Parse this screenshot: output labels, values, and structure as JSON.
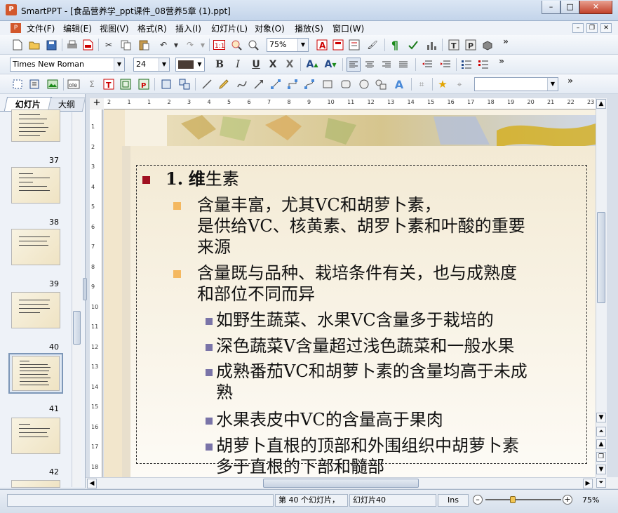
{
  "window": {
    "title": "SmartPPT - [食品营养学_ppt课件_08营养5章 (1).ppt]",
    "app_icon_letter": "P",
    "minimize": "–",
    "maximize": "□",
    "close": "✕"
  },
  "menu": {
    "items": [
      "文件(F)",
      "编辑(E)",
      "视图(V)",
      "格式(R)",
      "插入(I)",
      "幻灯片(L)",
      "对象(O)",
      "播放(S)",
      "窗口(W)"
    ],
    "mdi_min": "–",
    "mdi_restore": "❐",
    "mdi_close": "✕"
  },
  "toolbar1": {
    "zoom": "75%",
    "more": "»"
  },
  "toolbar2": {
    "font": "Times New Roman",
    "size": "24",
    "bold": "B",
    "italic": "I",
    "underline": "U",
    "strike": "X",
    "shadow": "X",
    "grow": "A",
    "shrink": "A",
    "more": "»"
  },
  "toolbar3": {
    "more": "»"
  },
  "panel": {
    "tabs": [
      "幻灯片",
      "大纲"
    ],
    "thumb_numbers": [
      "37",
      "38",
      "39",
      "40",
      "41",
      "42"
    ]
  },
  "ruler": {
    "corner": "+",
    "h_ticks": [
      "2",
      "1",
      "1",
      "2",
      "3",
      "4",
      "5",
      "6",
      "7",
      "8",
      "9",
      "10",
      "11",
      "12",
      "13",
      "14",
      "15",
      "16",
      "17",
      "18",
      "19",
      "20",
      "21",
      "22",
      "23",
      "24",
      "25"
    ],
    "v_ticks": [
      "1",
      "2",
      "3",
      "4",
      "5",
      "6",
      "7",
      "8",
      "9",
      "10",
      "11",
      "12",
      "13",
      "14",
      "15",
      "16",
      "17",
      "18"
    ]
  },
  "slide": {
    "heading_num": "1.",
    "heading_bold": "维",
    "heading_rest": "生素",
    "items": [
      {
        "level": 2,
        "lines": [
          "含量丰富，尤其VC和胡萝卜素，",
          "是供给VC、核黄素、胡罗卜素和叶酸的重要",
          "来源"
        ]
      },
      {
        "level": 2,
        "lines": [
          "含量既与品种、栽培条件有关，也与成熟度",
          "和部位不同而异"
        ]
      },
      {
        "level": 3,
        "lines": [
          "如野生蔬菜、水果VC含量多于栽培的"
        ]
      },
      {
        "level": 3,
        "lines": [
          "深色蔬菜V含量超过浅色蔬菜和一般水果"
        ]
      },
      {
        "level": 3,
        "lines": [
          "成熟番茄VC和胡萝卜素的含量均高于未成",
          "熟"
        ]
      },
      {
        "level": 3,
        "lines": [
          "水果表皮中VC的含量高于果肉"
        ]
      },
      {
        "level": 3,
        "lines": [
          "胡萝卜直根的顶部和外围组织中胡萝卜素",
          "多于直根的下部和髓部"
        ]
      }
    ]
  },
  "status": {
    "slide_pos": "第 40 个幻灯片，",
    "slide_name": "幻灯片40",
    "ins": "Ins",
    "zoom": "75%"
  }
}
